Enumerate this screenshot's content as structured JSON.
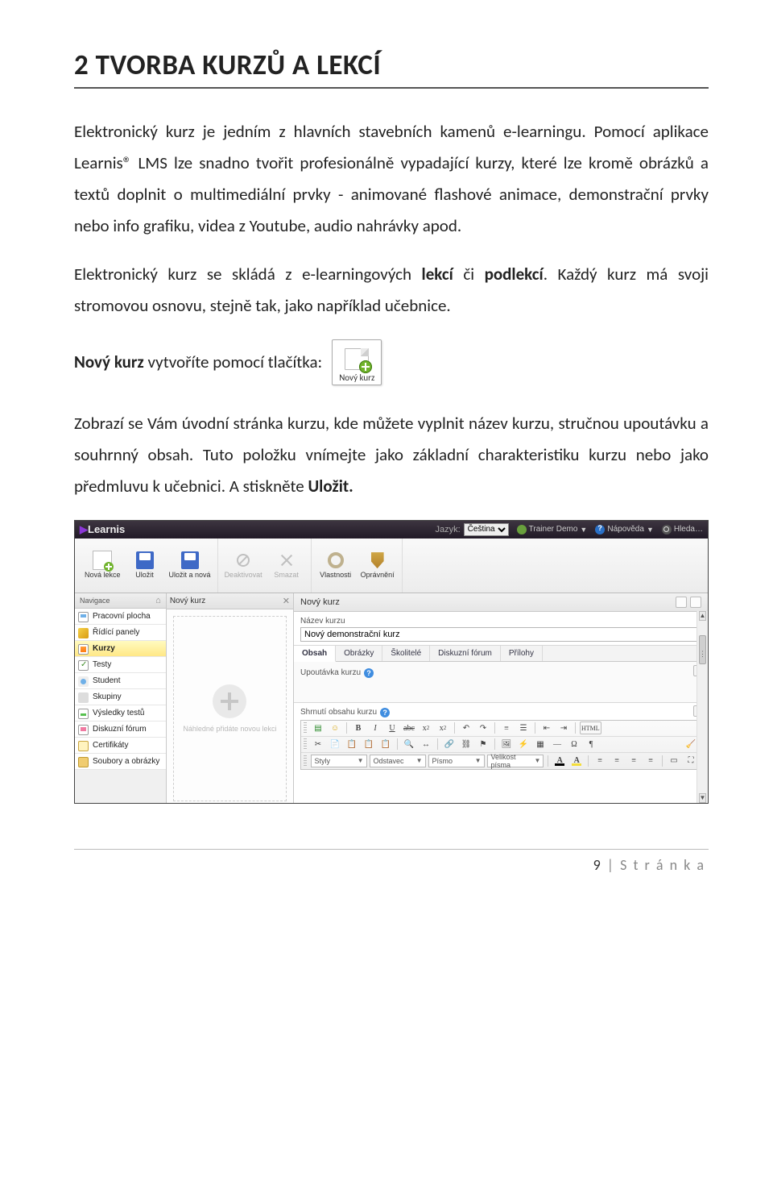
{
  "heading": "2   TVORBA KURZŮ A LEKCÍ",
  "p1": "Elektronický kurz je jedním z hlavních stavebních kamenů e-learningu. Pomocí aplikace Learnis® LMS lze snadno tvořit profesionálně vypadající kurzy, které lze kromě obrázků a textů doplnit o multimediální prvky - animované flashové animace, demonstrační prvky nebo info grafiku, videa z Youtube, audio nahrávky apod.",
  "p2_a": "Elektronický kurz se skládá z e-learningových ",
  "p2_b": "lekcí",
  "p2_c": " či ",
  "p2_d": "podlekcí",
  "p2_e": ". Každý kurz má svoji stromovou osnovu, stejně tak, jako například učebnice.",
  "p3_a": "Nový kurz",
  "p3_b": " vytvoříte pomocí tlačítka:",
  "new_course_label": "Nový kurz",
  "p4_a": "Zobrazí se Vám úvodní stránka kurzu, kde můžete vyplnit název kurzu, stručnou upoutávku a souhrnný obsah. Tuto položku vnímejte jako základní charakteristiku kurzu nebo jako předmluvu k učebnici. A stiskněte ",
  "p4_b": "Uložit.",
  "app": {
    "logo": "Learnis",
    "jazyk_label": "Jazyk:",
    "jazyk_value": "Čeština",
    "trainer": "Trainer Demo",
    "help": "Nápověda",
    "search": "Hleda…",
    "ribbon": {
      "new_lesson": "Nová lekce",
      "save": "Uložit",
      "save_new": "Uložit a nová",
      "deactivate": "Deaktivovat",
      "delete": "Smazat",
      "properties": "Vlastnosti",
      "permissions": "Oprávnění"
    },
    "nav_header": "Navigace",
    "nav": [
      "Pracovní plocha",
      "Řídící panely",
      "Kurzy",
      "Testy",
      "Student",
      "Skupiny",
      "Výsledky testů",
      "Diskuzní fórum",
      "Certifikáty",
      "Soubory a obrázky"
    ],
    "tree_header": "Nový kurz",
    "tree_placeholder": "Náhledné přidáte novou lekci",
    "breadcrumb": "Nový kurz",
    "name_label": "Název kurzu",
    "name_value": "Nový demonstrační kurz",
    "tabs": [
      "Obsah",
      "Obrázky",
      "Školitelé",
      "Diskuzní fórum",
      "Přílohy"
    ],
    "upoutavka_label": "Upoutávka kurzu",
    "shrnuti_label": "Shrnutí obsahu kurzu",
    "editor": {
      "styly": "Styly",
      "odstavec": "Odstavec",
      "pismo": "Písmo",
      "velikost": "Velikost písma"
    }
  },
  "footer_num": "9",
  "footer_text": " | S t r á n k a"
}
